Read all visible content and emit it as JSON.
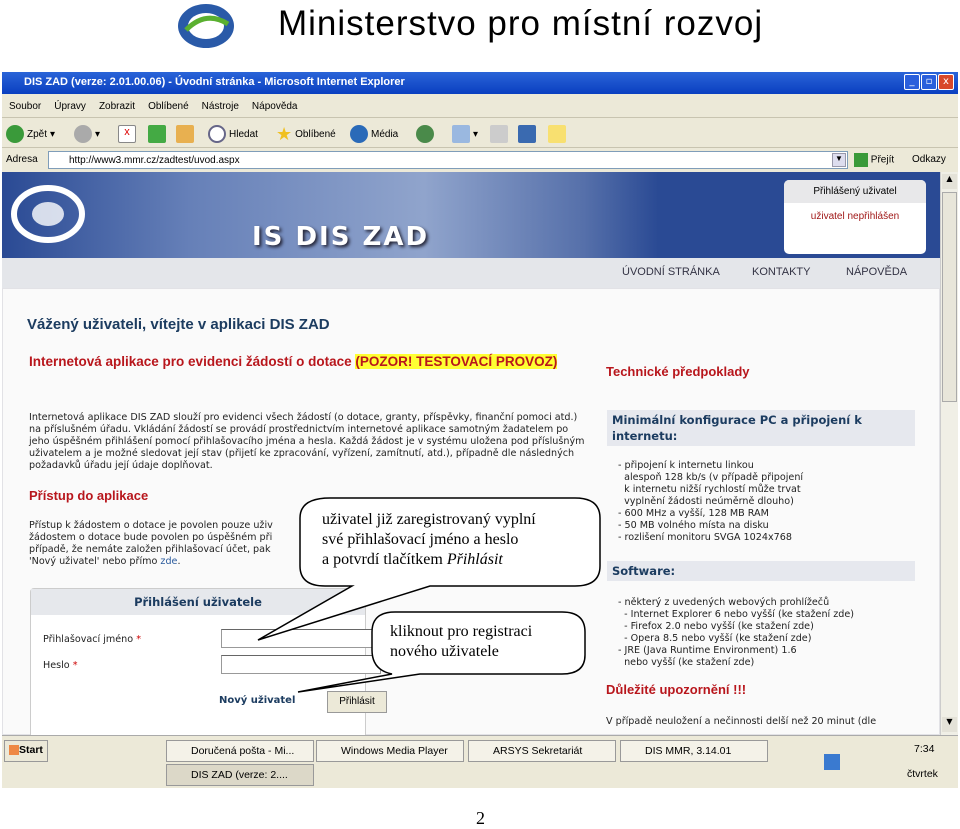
{
  "slide": {
    "title": "Ministerstvo pro místní rozvoj",
    "page_number": "2",
    "logo_text": "MINISTERSTVO PRO MÍSTNÍ ROZVOJ"
  },
  "browser": {
    "title": "DIS ZAD (verze: 2.01.00.06) - Úvodní stránka - Microsoft Internet Explorer",
    "menu": [
      "Soubor",
      "Úpravy",
      "Zobrazit",
      "Oblíbené",
      "Nástroje",
      "Nápověda"
    ],
    "toolbar": {
      "back": "Zpět",
      "search": "Hledat",
      "favorites": "Oblíbené",
      "media": "Média"
    },
    "address": {
      "label": "Adresa",
      "url": "http://www3.mmr.cz/zadtest/uvod.aspx",
      "go": "Přejít",
      "links": "Odkazy"
    }
  },
  "site": {
    "banner_title": "IS DIS ZAD",
    "user_box": {
      "label": "Přihlášený uživatel",
      "status": "uživatel nepřihlášen"
    },
    "nav": [
      "ÚVODNÍ STRÁNKA",
      "KONTAKTY",
      "NÁPOVĚDA"
    ],
    "welcome": "Vážený uživateli, vítejte v aplikaci DIS ZAD",
    "intro_heading": "Internetová aplikace pro evidenci žádostí o dotace ",
    "intro_highlight": "(POZOR! TESTOVACÍ PROVOZ)",
    "intro_text": "Internetová aplikace DIS ZAD slouží pro evidenci všech žádostí (o dotace, granty, příspěvky, finanční pomoci atd.) na příslušném úřadu. Vkládání žádostí se provádí prostřednictvím internetové aplikace samotným žadatelem po jeho úspěšném přihlášení pomocí přihlašovacího jména a hesla. Každá žádost je v systému uložena pod příslušným uživatelem a je možné sledovat její stav (přijetí ke zpracování, vyřízení, zamítnutí, atd.), případně dle následných požadavků úřadu její údaje doplňovat.",
    "access_heading": "Přístup do aplikace",
    "access_lines": [
      "Přístup k žádostem o dotace je povolen pouze uživ",
      "žádostem o dotace bude povolen po úspěšném při",
      "případě, že nemáte založen přihlašovací účet, pak",
      "'Nový uživatel' nebo přímo "
    ],
    "access_link": "zde",
    "access_end": ".",
    "login": {
      "heading": "Přihlášení uživatele",
      "username_label": "Přihlašovací jméno",
      "password_label": "Heslo",
      "required": "*",
      "username_value": "",
      "password_value": "",
      "new_user": "Nový uživatel",
      "submit": "Přihlásit"
    },
    "tech_heading": "Technické předpoklady",
    "hw_heading": "Minimální konfigurace PC a připojení k internetu:",
    "hw_list": "- připojení k internetu linkou\n  alespoň 128 kb/s (v případě připojení\n  k internetu nižší rychlostí může trvat\n  vyplnění žádosti neúměrně dlouho)\n- 600 MHz a vyšší, 128 MB RAM\n- 50 MB volného místa na disku\n- rozlišení monitoru SVGA 1024x768",
    "sw_heading": "Software:",
    "sw_list": "- některý z uvedených webových prohlížečů\n  - Internet Explorer 6 nebo vyšší (ke stažení zde)\n  - Firefox 2.0 nebo vyšší (ke stažení zde)\n  - Opera 8.5 nebo vyšší (ke stažení zde)\n- JRE (Java Runtime Environment) 1.6\n  nebo vyšší (ke stažení zde)",
    "warning_heading": "Důležité upozornění !!!",
    "warning_text": "V případě neuložení a nečinnosti delší než 20 minut (dle"
  },
  "callouts": {
    "login": [
      "uživatel již zaregistrovaný vyplní",
      "své přihlašovací jméno a heslo",
      "a potvrdí tlačítkem "
    ],
    "login_italic": "Přihlásit",
    "register": [
      "kliknout pro registraci",
      "nového uživatele"
    ]
  },
  "taskbar": {
    "start": "Start",
    "tasks": [
      "Doručená pošta - Mi...",
      "Windows Media Player",
      "ARSYS Sekretariát",
      "DIS MMR, 3.14.01",
      "DIS ZAD (verze: 2...."
    ],
    "clock": "7:34",
    "day": "čtvrtek"
  }
}
